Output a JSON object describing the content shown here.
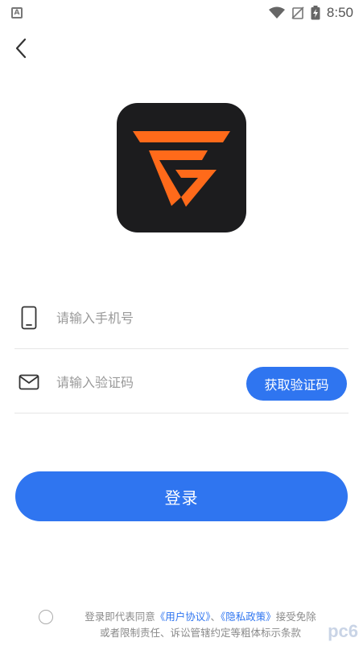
{
  "status_bar": {
    "notification_icon": "A",
    "time": "8:50",
    "icons": [
      "wifi-icon",
      "signal-off-icon",
      "battery-charging-icon"
    ]
  },
  "header": {
    "back_icon": "chevron-left-icon"
  },
  "logo": {
    "icon": "app-logo-icon",
    "colors": {
      "background": "#1c1c1e",
      "accent": "#ff6a1a"
    }
  },
  "form": {
    "phone": {
      "icon": "phone-icon",
      "placeholder": "请输入手机号",
      "value": ""
    },
    "code": {
      "icon": "mail-icon",
      "placeholder": "请输入验证码",
      "value": "",
      "button_label": "获取验证码"
    }
  },
  "login": {
    "label": "登录"
  },
  "agreement": {
    "prefix": "登录即代表同意",
    "user_agreement": "《用户协议》",
    "separator": "、",
    "privacy_policy": "《隐私政策》",
    "suffix_line1": "接受免除",
    "line2": "或者限制责任、诉讼管辖约定等粗体标示条款"
  },
  "watermark": {
    "text": "pc6"
  },
  "colors": {
    "primary": "#2f75f0",
    "text_muted": "#8a8a8a",
    "divider": "#e6e6e6"
  }
}
